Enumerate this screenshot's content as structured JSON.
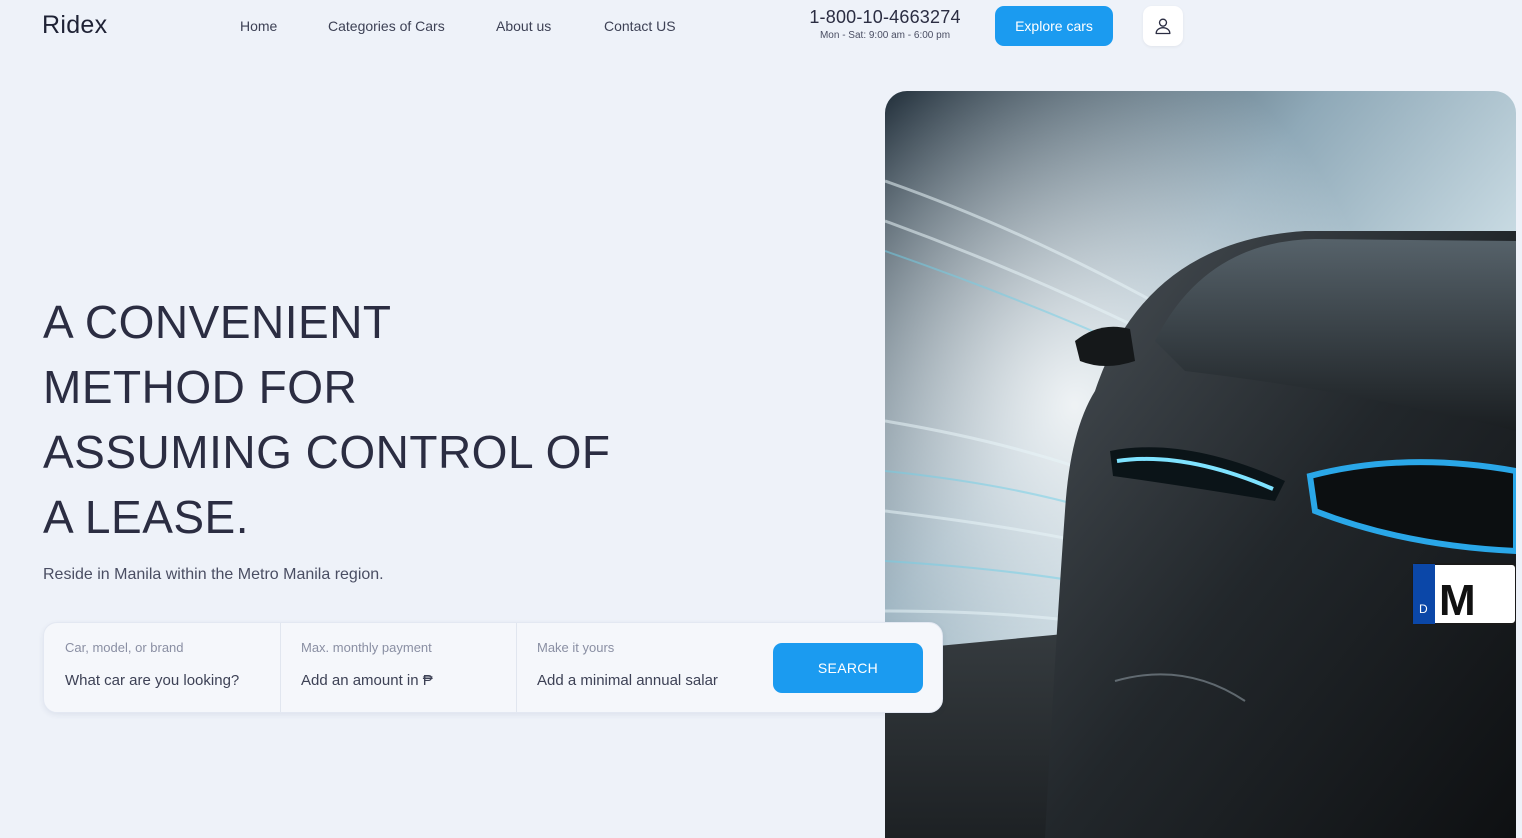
{
  "header": {
    "logo": "Ridex",
    "nav": [
      {
        "label": "Home"
      },
      {
        "label": "Categories of Cars"
      },
      {
        "label": "About us"
      },
      {
        "label": "Contact US"
      }
    ],
    "phone": "1-800-10-4663274",
    "hours": "Mon - Sat: 9:00 am - 6:00 pm",
    "explore_label": "Explore cars",
    "user_icon": "user-icon"
  },
  "hero": {
    "title_lines": [
      "A CONVENIENT",
      "METHOD FOR",
      "ASSUMING CONTROL OF",
      "A LEASE."
    ],
    "subtitle": "Reside in Manila within the Metro Manila region."
  },
  "search": {
    "fields": [
      {
        "label": "Car, model, or brand",
        "placeholder": "What car are you looking?"
      },
      {
        "label": "Max. monthly payment",
        "placeholder": "Add an amount in ₱"
      },
      {
        "label": "Make it yours",
        "placeholder": "Add a minimal annual salar"
      }
    ],
    "button_label": "SEARCH"
  },
  "image": {
    "plate_country": "D",
    "plate_text": "M"
  },
  "colors": {
    "accent": "#1b9bf0",
    "background": "#eef2f9",
    "text": "#2b2d42"
  }
}
